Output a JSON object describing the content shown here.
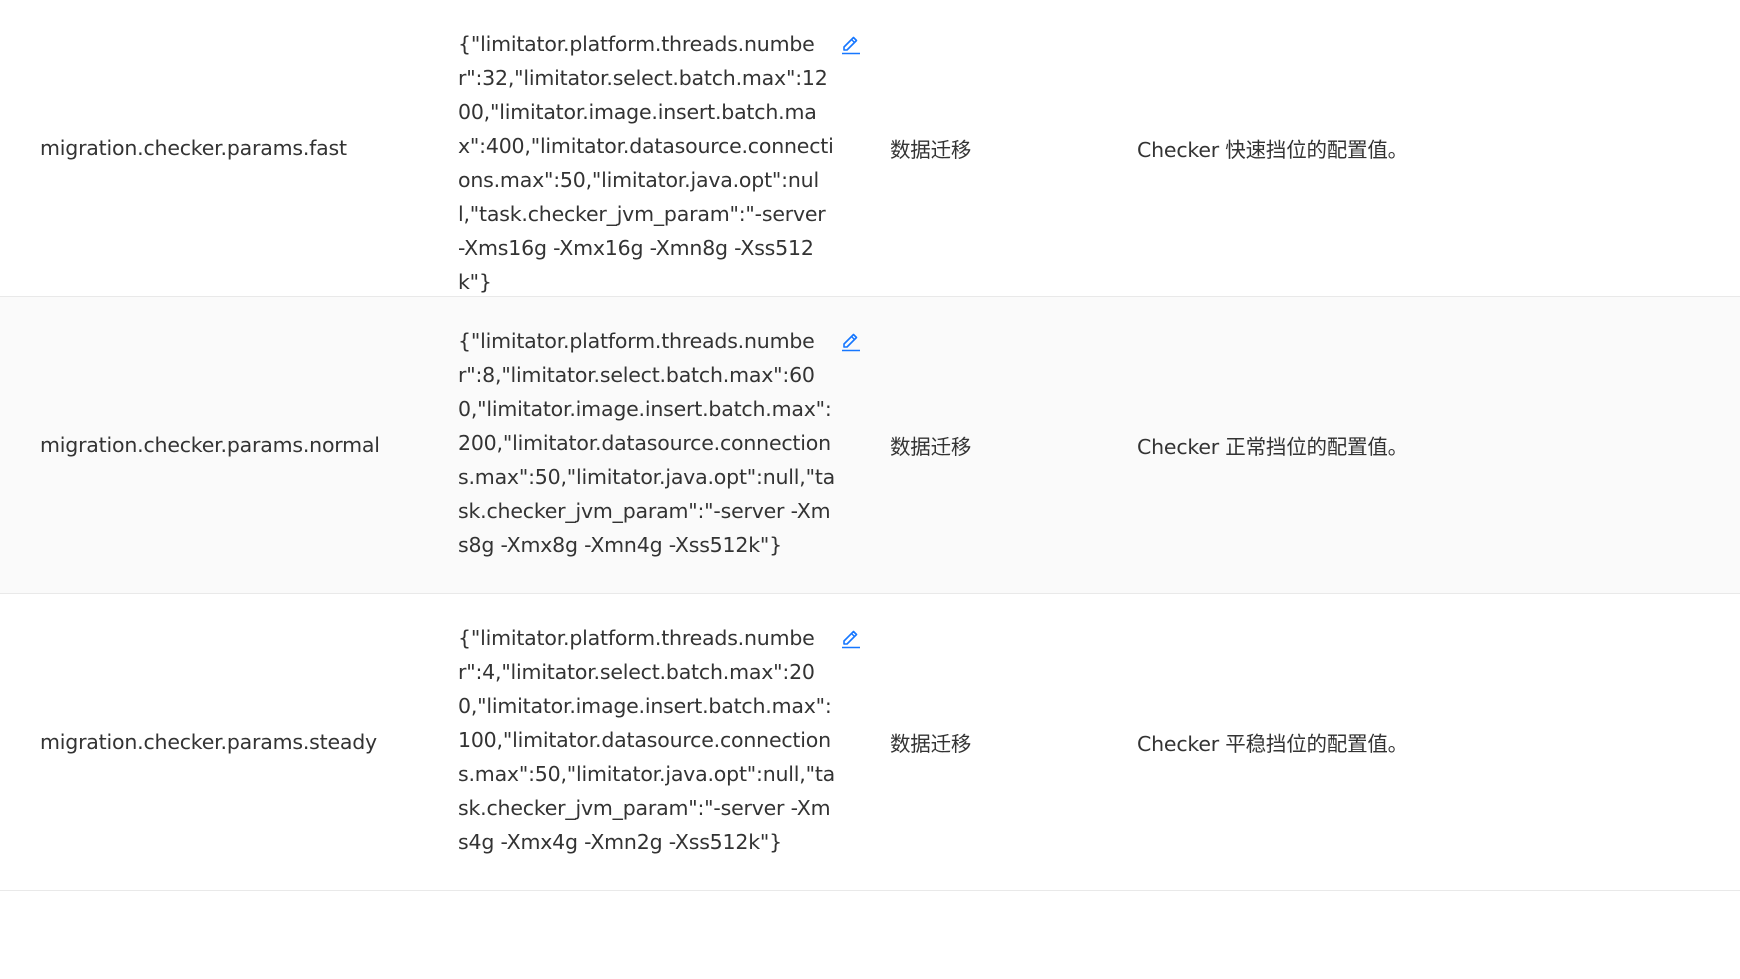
{
  "rows": [
    {
      "name": "migration.checker.params.fast",
      "value": "{\"limitator.platform.threads.number\":32,\"limitator.select.batch.max\":1200,\"limitator.image.insert.batch.max\":400,\"limitator.datasource.connections.max\":50,\"limitator.java.opt\":null,\"task.checker_jvm_param\":\"-server -Xms16g -Xmx16g -Xmn8g -Xss512k\"}",
      "module": "数据迁移",
      "description": "Checker 快速挡位的配置值。"
    },
    {
      "name": "migration.checker.params.normal",
      "value": "{\"limitator.platform.threads.number\":8,\"limitator.select.batch.max\":600,\"limitator.image.insert.batch.max\":200,\"limitator.datasource.connections.max\":50,\"limitator.java.opt\":null,\"task.checker_jvm_param\":\"-server -Xms8g -Xmx8g -Xmn4g -Xss512k\"}",
      "module": "数据迁移",
      "description": "Checker 正常挡位的配置值。"
    },
    {
      "name": "migration.checker.params.steady",
      "value": "{\"limitator.platform.threads.number\":4,\"limitator.select.batch.max\":200,\"limitator.image.insert.batch.max\":100,\"limitator.datasource.connections.max\":50,\"limitator.java.opt\":null,\"task.checker_jvm_param\":\"-server -Xms4g -Xmx4g -Xmn2g -Xss512k\"}",
      "module": "数据迁移",
      "description": "Checker 平稳挡位的配置值。"
    }
  ],
  "icons": {
    "edit": "edit-icon"
  },
  "colors": {
    "text": "#333333",
    "accent": "#1677ff",
    "alt_row_bg": "#fafafa",
    "border": "#e9e9e9"
  }
}
